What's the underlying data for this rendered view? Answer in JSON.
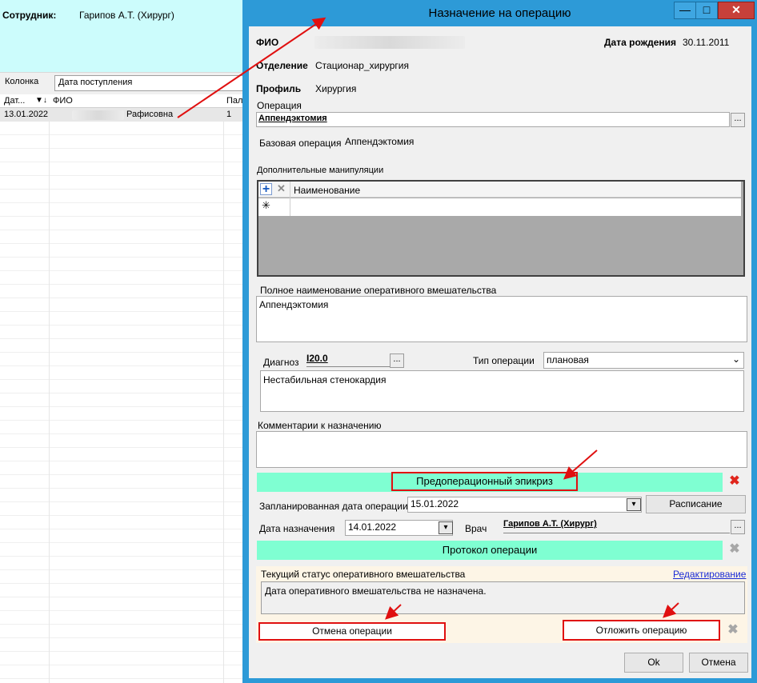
{
  "background_window": {
    "employee_label": "Сотрудник:",
    "employee_value": "Гарипов А.Т. (Хирург)",
    "column_label": "Колонка",
    "column_value": "Дата поступления",
    "grid_headers": [
      "Дат...",
      "ФИО",
      "Пала"
    ],
    "row": {
      "date": "13.01.2022",
      "fio_visible": "Рафисовна",
      "ward": "1"
    }
  },
  "dialog": {
    "title": "Назначение на операцию",
    "window_buttons": {
      "minimize": "—",
      "maximize": "□",
      "close": "✕"
    },
    "fio_label": "ФИО",
    "birth_label": "Дата рождения",
    "birth_value": "30.11.2011",
    "dept_label": "Отделение",
    "dept_value": "Стационар_хирургия",
    "profile_label": "Профиль",
    "profile_value": "Хирургия",
    "operation_label": "Операция",
    "operation_value": "Аппендэктомия",
    "base_op_label": "Базовая операция",
    "base_op_value": "Аппендэктомия",
    "manip_label": "Дополнительные манипуляции",
    "manip_col_header": "Наименование",
    "manip_new_row_marker": "✳",
    "fullname_label": "Полное наименование оперативного вмешательства",
    "fullname_value": "Аппендэктомия",
    "diag_label": "Диагноз",
    "diag_value": "I20.0",
    "optype_label": "Тип операции",
    "optype_value": "плановая",
    "diag_text": "Нестабильная стенокардия",
    "comments_label": "Комментарии к назначению",
    "comments_value": "",
    "preop_button": "Предоперационный эпикриз",
    "planned_date_label": "Запланированная дата операции",
    "planned_date_value": "15.01.2022",
    "schedule_button": "Расписание",
    "assign_date_label": "Дата назначения",
    "assign_date_value": "14.01.2022",
    "doctor_label": "Врач",
    "doctor_value": "Гарипов А.Т. (Хирург)",
    "protocol_button": "Протокол операции",
    "status_label": "Текущий статус оперативного вмешательства",
    "edit_link": "Редактирование",
    "status_text": "Дата оперативного вмешательства не назначена.",
    "cancel_op_button": "Отмена операции",
    "postpone_button": "Отложить операцию",
    "ok_button": "Ok",
    "cancel_button": "Отмена",
    "ellipsis": "...",
    "dropdown_arrow": "▾"
  },
  "colors": {
    "title_bar": "#2d9ad7",
    "green_buttons": "#7fffd2",
    "annotation_red": "#e01010",
    "link": "#1a2bd6"
  }
}
